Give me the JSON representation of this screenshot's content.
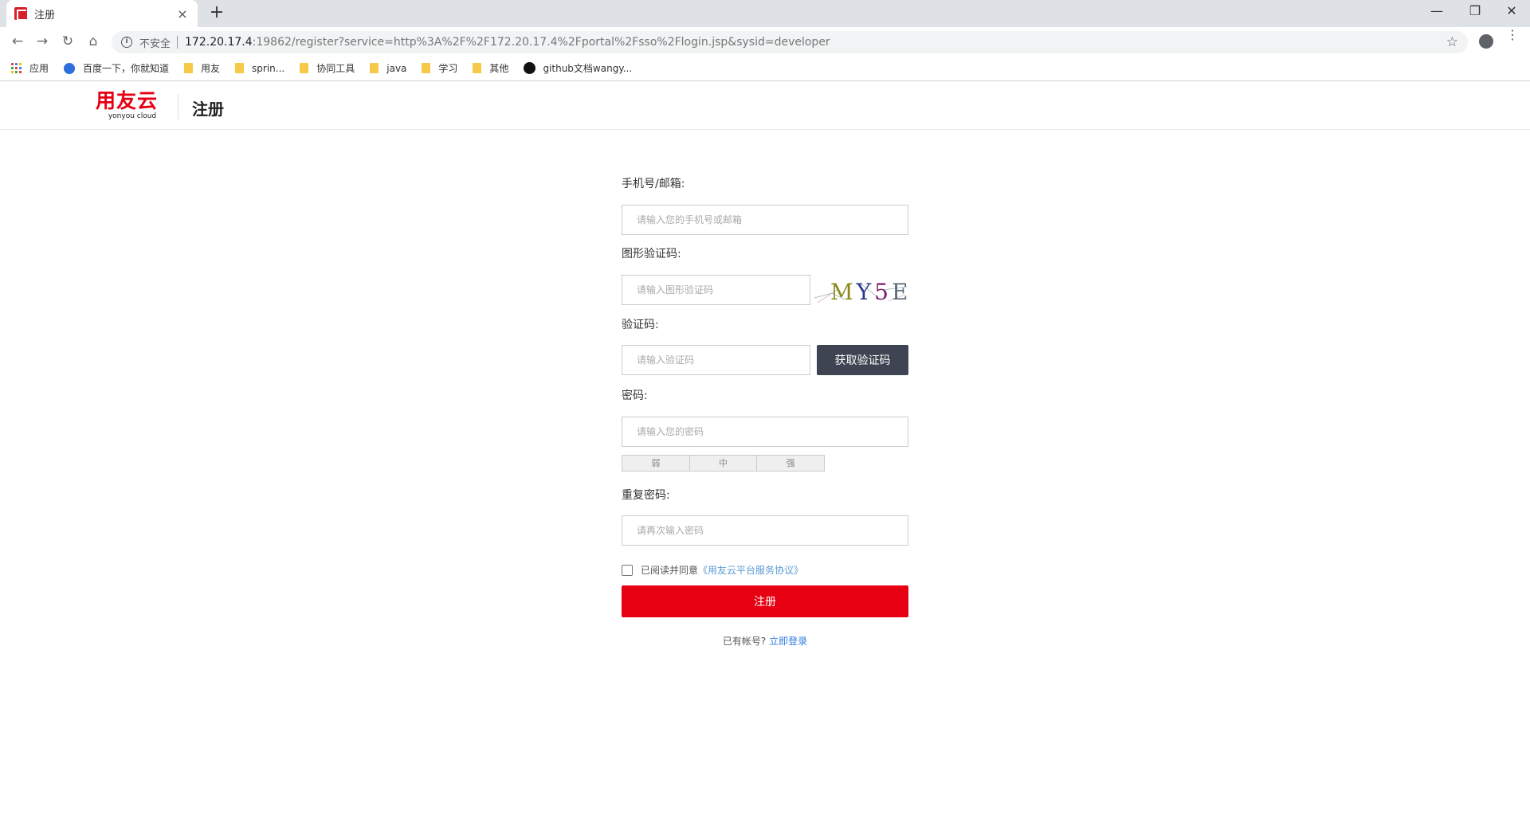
{
  "browser": {
    "tab_title": "注册",
    "tab_close": "×",
    "new_tab": "+",
    "window_controls": {
      "minimize": "—",
      "restore": "❐",
      "close": "✕"
    },
    "nav": {
      "back": "←",
      "forward": "→",
      "reload": "↻",
      "home": "⌂"
    },
    "address": {
      "info_glyph": "i",
      "security_label": "不安全",
      "host": "172.20.17.4",
      "path": ":19862/register?service=http%3A%2F%2F172.20.17.4%2Fportal%2Fsso%2Flogin.jsp&sysid=developer"
    },
    "bookmark_star": "☆",
    "menu": "⋮",
    "bookmarks": [
      {
        "label": "应用",
        "icon": "apps-grid-icon"
      },
      {
        "label": "百度一下，你就知道",
        "icon": "baidu-paw-icon"
      },
      {
        "label": "用友",
        "icon": "folder-icon"
      },
      {
        "label": "sprin...",
        "icon": "folder-icon"
      },
      {
        "label": "协同工具",
        "icon": "folder-icon"
      },
      {
        "label": "java",
        "icon": "folder-icon"
      },
      {
        "label": "学习",
        "icon": "folder-icon"
      },
      {
        "label": "其他",
        "icon": "folder-icon"
      },
      {
        "label": "github文档wangy...",
        "icon": "github-icon"
      }
    ]
  },
  "header": {
    "logo_cn": "用友云",
    "logo_en": "yonyou cloud",
    "title": "注册"
  },
  "form": {
    "account": {
      "label": "手机号/邮箱:",
      "placeholder": "请输入您的手机号或邮箱",
      "value": ""
    },
    "captcha": {
      "label": "图形验证码:",
      "placeholder": "请输入图形验证码",
      "value": "",
      "image_text": "MY5E"
    },
    "sms": {
      "label": "验证码:",
      "placeholder": "请输入验证码",
      "value": "",
      "button": "获取验证码"
    },
    "password": {
      "label": "密码:",
      "placeholder": "请输入您的密码",
      "value": "",
      "strength_levels": [
        "弱",
        "中",
        "强"
      ]
    },
    "confirm": {
      "label": "重复密码:",
      "placeholder": "请再次输入密码",
      "value": ""
    },
    "agreement": {
      "prefix": "已阅读并同意",
      "link": "《用友云平台服务协议》",
      "checked": false
    },
    "submit": "注册",
    "login_prompt": "已有帐号?",
    "login_link": "立即登录"
  },
  "colors": {
    "brand_red": "#e60012",
    "sms_button": "#3f4452",
    "link_blue": "#2f7be0"
  }
}
